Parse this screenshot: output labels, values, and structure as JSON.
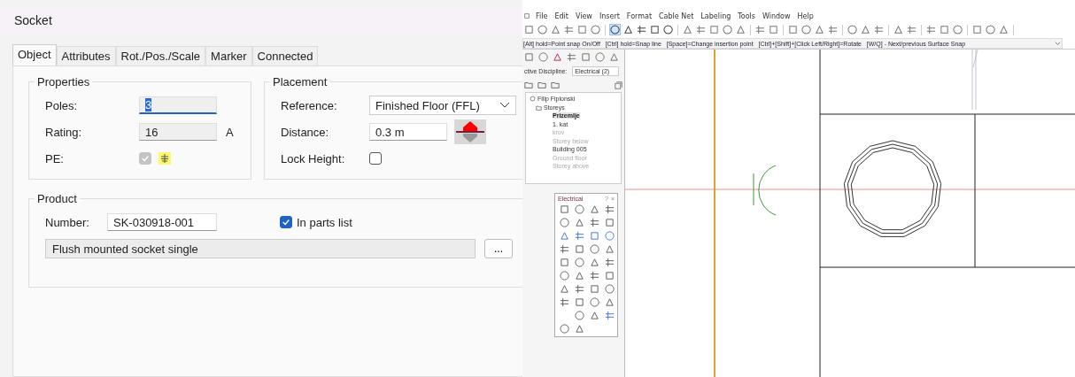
{
  "dialog": {
    "title": "Socket",
    "tabs": [
      {
        "label": "Object",
        "selected": true
      },
      {
        "label": "Attributes",
        "selected": false
      },
      {
        "label": "Rot./Pos./Scale",
        "selected": false
      },
      {
        "label": "Marker",
        "selected": false
      },
      {
        "label": "Connected",
        "selected": false
      }
    ],
    "properties": {
      "legend": "Properties",
      "poles": {
        "label": "Poles:",
        "value": "3",
        "focused": true
      },
      "rating": {
        "label": "Rating:",
        "value": "16",
        "unit": "A"
      },
      "pe": {
        "label": "PE:",
        "checked": true,
        "disabled": true
      }
    },
    "placement": {
      "legend": "Placement",
      "reference": {
        "label": "Reference:",
        "value": "Finished Floor (FFL)"
      },
      "distance": {
        "label": "Distance:",
        "value": "0.3 m"
      },
      "lock_height": {
        "label": "Lock Height:",
        "checked": false
      }
    },
    "product": {
      "legend": "Product",
      "number": {
        "label": "Number:",
        "value": "SK-030918-001"
      },
      "in_parts_list": {
        "label": "In parts list",
        "checked": true
      },
      "description": "Flush mounted socket single",
      "browse_button": "..."
    }
  },
  "app": {
    "menu": [
      "File",
      "Edit",
      "View",
      "Insert",
      "Format",
      "Cable Net",
      "Labeling",
      "Tools",
      "Window",
      "Help"
    ],
    "hint": "[Alt] hold=Point snap On/Off   [Ctrl] hold=Snap line   [Space]=Change insertion point   [Ctrl]+[Shift]+[Click Left/Right]=Rotate   [W/Q] - Next/previous Surface Snap",
    "discipline": {
      "label": "ctive Discipline:",
      "value": "Electrical (2)"
    },
    "tree": [
      {
        "label": "Filip Fiplonski",
        "kind": "project",
        "children": [
          {
            "label": "Storeys",
            "kind": "folder",
            "children": [
              {
                "label": "Prizemlje",
                "selected": true,
                "disabled": false
              },
              {
                "label": "1. kat",
                "selected": false,
                "disabled": false
              },
              {
                "label": "krov",
                "selected": false,
                "disabled": true
              },
              {
                "label": "Storey below",
                "selected": false,
                "disabled": true
              },
              {
                "label": "Building 005",
                "selected": false,
                "disabled": false
              },
              {
                "label": "Ground floor",
                "selected": false,
                "disabled": true
              },
              {
                "label": "Storey above",
                "selected": false,
                "disabled": true
              }
            ]
          }
        ]
      }
    ],
    "palette": {
      "title": "Electrical",
      "help": "?",
      "close": "×"
    }
  }
}
